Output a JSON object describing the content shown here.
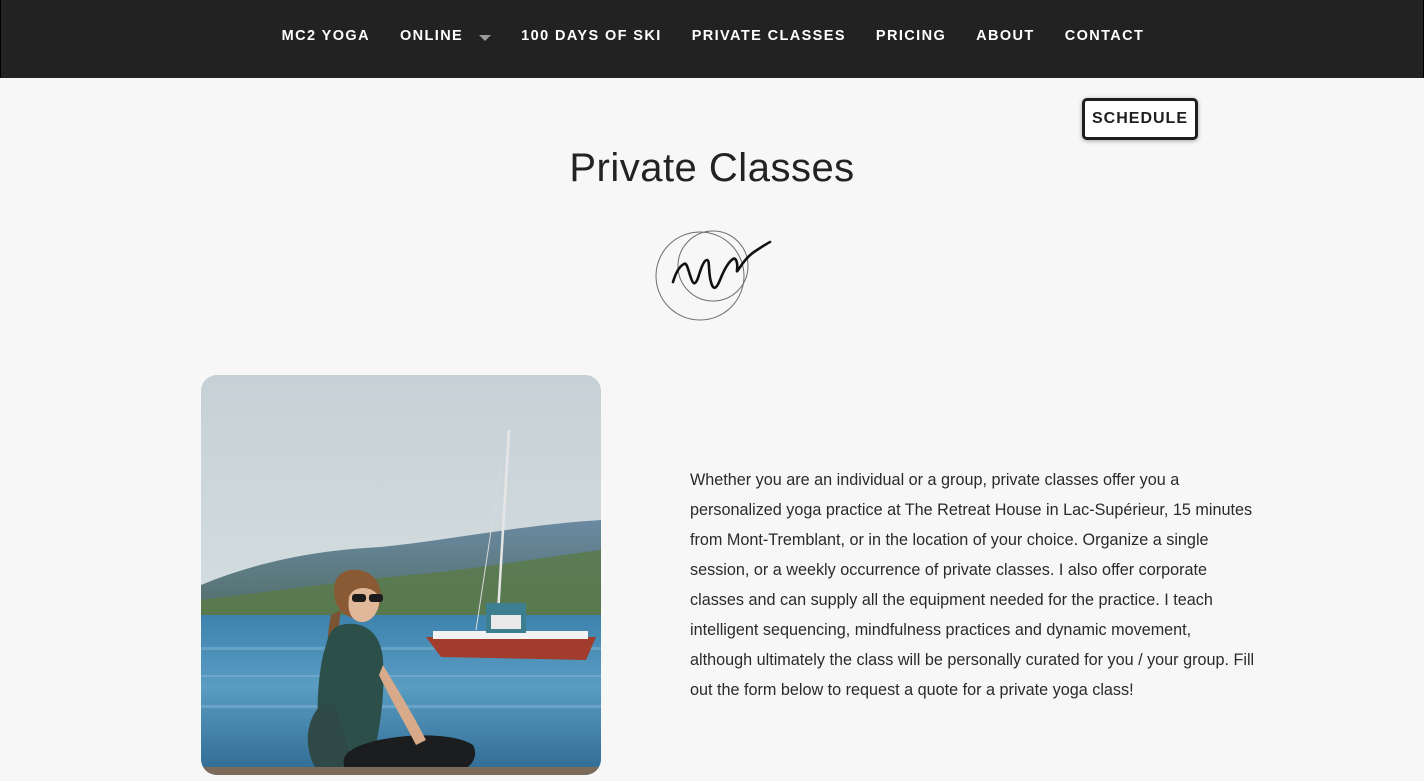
{
  "nav": {
    "items": [
      {
        "label": "MC2 YOGA"
      },
      {
        "label": "ONLINE",
        "has_dropdown": true
      },
      {
        "label": "100 DAYS OF SKI"
      },
      {
        "label": "PRIVATE CLASSES"
      },
      {
        "label": "PRICING"
      },
      {
        "label": "ABOUT"
      },
      {
        "label": "CONTACT"
      }
    ]
  },
  "schedule_button": {
    "label": "SCHEDULE"
  },
  "page": {
    "title": "Private Classes",
    "intro": "Whether you are an individual or a group, private classes offer you a personalized yoga practice at The Retreat House in Lac-Supérieur, 15 minutes from Mont-Tremblant, or in the location of your choice. Organize a single session, or a weekly occurrence of private classes. I also offer corporate classes and can supply all the equipment needed for the practice. I teach intelligent sequencing, mindfulness practices and dynamic movement, although ultimately the class will be personally curated for you / your group. Fill out the form below to request a quote for a private yoga class!"
  },
  "colors": {
    "nav_background": "#222222",
    "page_background": "#f7f7f7",
    "text": "#232323"
  },
  "icons": {
    "dropdown": "chevron-down-icon",
    "logo": "signature-logo"
  }
}
